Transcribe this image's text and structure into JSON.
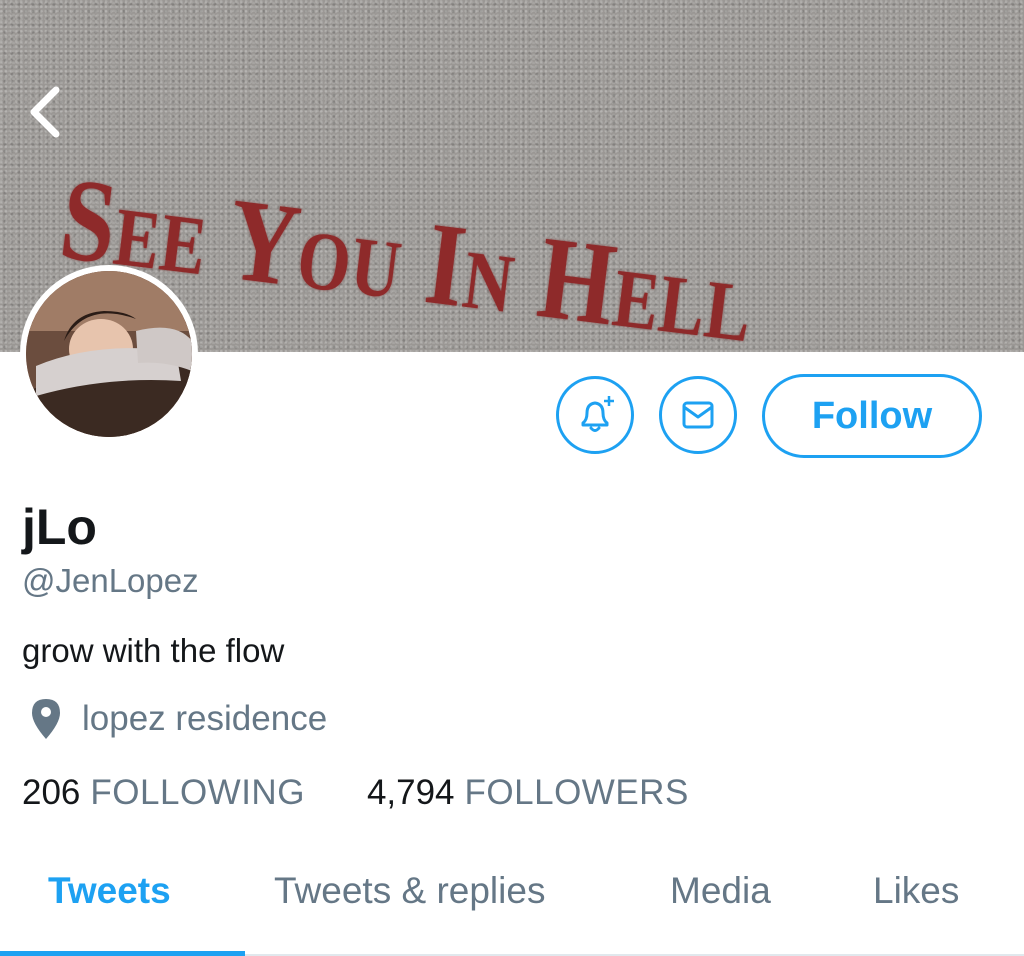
{
  "banner": {
    "text": "See You In Hell"
  },
  "header": {
    "back_icon": "chevron-left-icon"
  },
  "profile": {
    "avatar": "avatar-photo",
    "display_name": "jLo",
    "handle": "@JenLopez",
    "bio": "grow with the flow",
    "location": "lopez residence",
    "location_icon": "map-pin-icon"
  },
  "actions": {
    "notify_icon": "bell-plus-icon",
    "message_icon": "envelope-icon",
    "follow_label": "Follow"
  },
  "stats": {
    "following_count": "206",
    "following_label": "FOLLOWING",
    "followers_count": "4,794",
    "followers_label": "FOLLOWERS"
  },
  "tabs": [
    {
      "label": "Tweets",
      "active": true
    },
    {
      "label": "Tweets & replies",
      "active": false
    },
    {
      "label": "Media",
      "active": false
    },
    {
      "label": "Likes",
      "active": false
    }
  ],
  "colors": {
    "accent": "#1da1f2",
    "text_primary": "#14171a",
    "text_secondary": "#657786",
    "banner_text": "#8e2a2a"
  }
}
